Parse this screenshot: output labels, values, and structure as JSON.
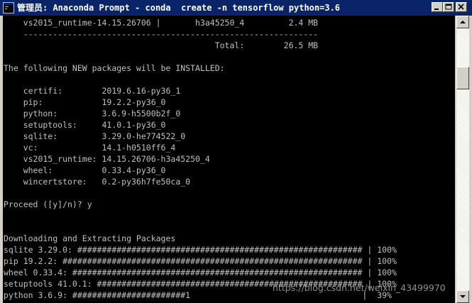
{
  "window": {
    "title": "管理员: Anaconda Prompt - conda  create -n tensorflow python=3.6"
  },
  "console": {
    "lines": [
      "    vs2015_runtime-14.15.26706 |       h3a45250_4         2.4 MB",
      "    ------------------------------------------------------------",
      "                                           Total:        26.5 MB",
      "",
      "The following NEW packages will be INSTALLED:",
      "",
      "    certifi:        2019.6.16-py36_1",
      "    pip:            19.2.2-py36_0",
      "    python:         3.6.9-h5500b2f_0",
      "    setuptools:     41.0.1-py36_0",
      "    sqlite:         3.29.0-he774522_0",
      "    vc:             14.1-h0510ff6_4",
      "    vs2015_runtime: 14.15.26706-h3a45250_4",
      "    wheel:          0.33.4-py36_0",
      "    wincertstore:   0.2-py36h7fe50ca_0",
      "",
      "Proceed ([y]/n)? y",
      "",
      "",
      "Downloading and Extracting Packages",
      "sqlite 3.29.0: ########################################################## | 100%",
      "pip 19.2.2: ############################################################# | 100%",
      "wheel 0.33.4: ########################################################### | 100%",
      "setuptools 41.0.1: ###################################################### | 100%",
      "python 3.6.9: #######################1                                   |  39%"
    ]
  },
  "watermark": "https://blog.csdn.net/weixin_43499970"
}
